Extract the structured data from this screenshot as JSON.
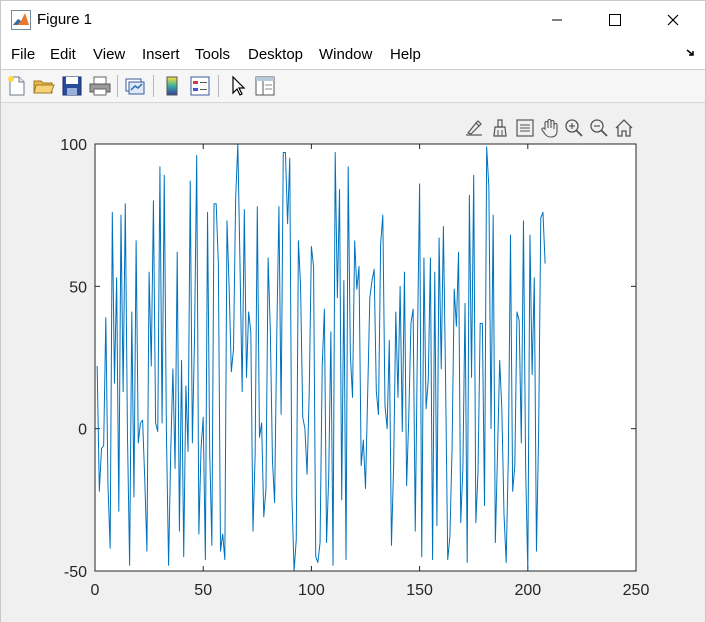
{
  "window": {
    "title": "Figure 1",
    "controls": [
      "minimize",
      "maximize",
      "close"
    ]
  },
  "menubar": {
    "items": [
      "File",
      "Edit",
      "View",
      "Insert",
      "Tools",
      "Desktop",
      "Window",
      "Help"
    ]
  },
  "toolbar": {
    "buttons": [
      "new-figure-icon",
      "open-file-icon",
      "save-icon",
      "print-icon",
      "link-plot-icon",
      "insert-colorbar-icon",
      "insert-legend-icon",
      "edit-plot-arrow-icon",
      "property-inspector-icon"
    ]
  },
  "axes_toolbar": {
    "buttons": [
      "brush-edit-icon",
      "data-brush-icon",
      "data-tips-icon",
      "pan-hand-icon",
      "zoom-in-icon",
      "zoom-out-icon",
      "home-restore-icon"
    ]
  },
  "colors": {
    "line": "#0072BD",
    "axes_bg": "#ffffff",
    "figure_bg": "#f0f0f0"
  },
  "chart_data": {
    "type": "line",
    "title": "",
    "xlabel": "",
    "ylabel": "",
    "xlim": [
      0,
      250
    ],
    "ylim": [
      -50,
      100
    ],
    "xticks": [
      0,
      50,
      100,
      150,
      200,
      250
    ],
    "yticks": [
      -50,
      0,
      50,
      100
    ],
    "xtick_labels": [
      "0",
      "50",
      "100",
      "150",
      "200",
      "250"
    ],
    "ytick_labels": [
      "-50",
      "0",
      "50",
      "100"
    ],
    "grid": false,
    "series": [
      {
        "values": [
          22,
          -22,
          -7,
          -6,
          39,
          -20,
          -42,
          76,
          16,
          53,
          -29,
          75,
          13,
          79,
          -2,
          -48,
          41,
          -24,
          66,
          -5,
          2,
          3,
          -18,
          -43,
          55,
          22,
          80,
          2,
          -1,
          92,
          2,
          89,
          -1,
          -48,
          -8,
          21,
          -14,
          62,
          -36,
          24,
          -45,
          15,
          -8,
          87,
          -5,
          32,
          96,
          -37,
          -7,
          4,
          -46,
          76,
          -8,
          -41,
          79,
          79,
          58,
          -43,
          -37,
          -46,
          73,
          49,
          20,
          28,
          81,
          100,
          58,
          13,
          77,
          18,
          41,
          34,
          -36,
          -9,
          78,
          -3,
          2,
          -31,
          -21,
          60,
          35,
          -11,
          -26,
          33,
          78,
          5,
          97,
          97,
          72,
          95,
          -24,
          -50,
          -39,
          66,
          50,
          4,
          0,
          -16,
          13,
          64,
          57,
          -45,
          -47,
          -40,
          22,
          42,
          -40,
          -17,
          34,
          -48,
          97,
          46,
          84,
          -25,
          52,
          -46,
          92,
          26,
          11,
          66,
          49,
          57,
          -13,
          -4,
          -21,
          12,
          46,
          52,
          56,
          13,
          5,
          65,
          75,
          8,
          0,
          31,
          -41,
          -13,
          41,
          11,
          50,
          -1,
          55,
          -20,
          4,
          37,
          42,
          -36,
          30,
          86,
          -45,
          60,
          7,
          17,
          60,
          -46,
          55,
          -34,
          67,
          21,
          71,
          17,
          -46,
          -38,
          -7,
          49,
          36,
          62,
          -33,
          -14,
          44,
          -47,
          82,
          18,
          89,
          -33,
          -15,
          37,
          37,
          -27,
          99,
          85,
          0,
          75,
          -40,
          -9,
          24,
          7,
          -30,
          -47,
          -10,
          68,
          -22,
          -13,
          41,
          38,
          -5,
          73,
          -14,
          -51,
          68,
          19,
          53,
          -43,
          -2,
          74,
          76,
          58
        ]
      }
    ]
  }
}
